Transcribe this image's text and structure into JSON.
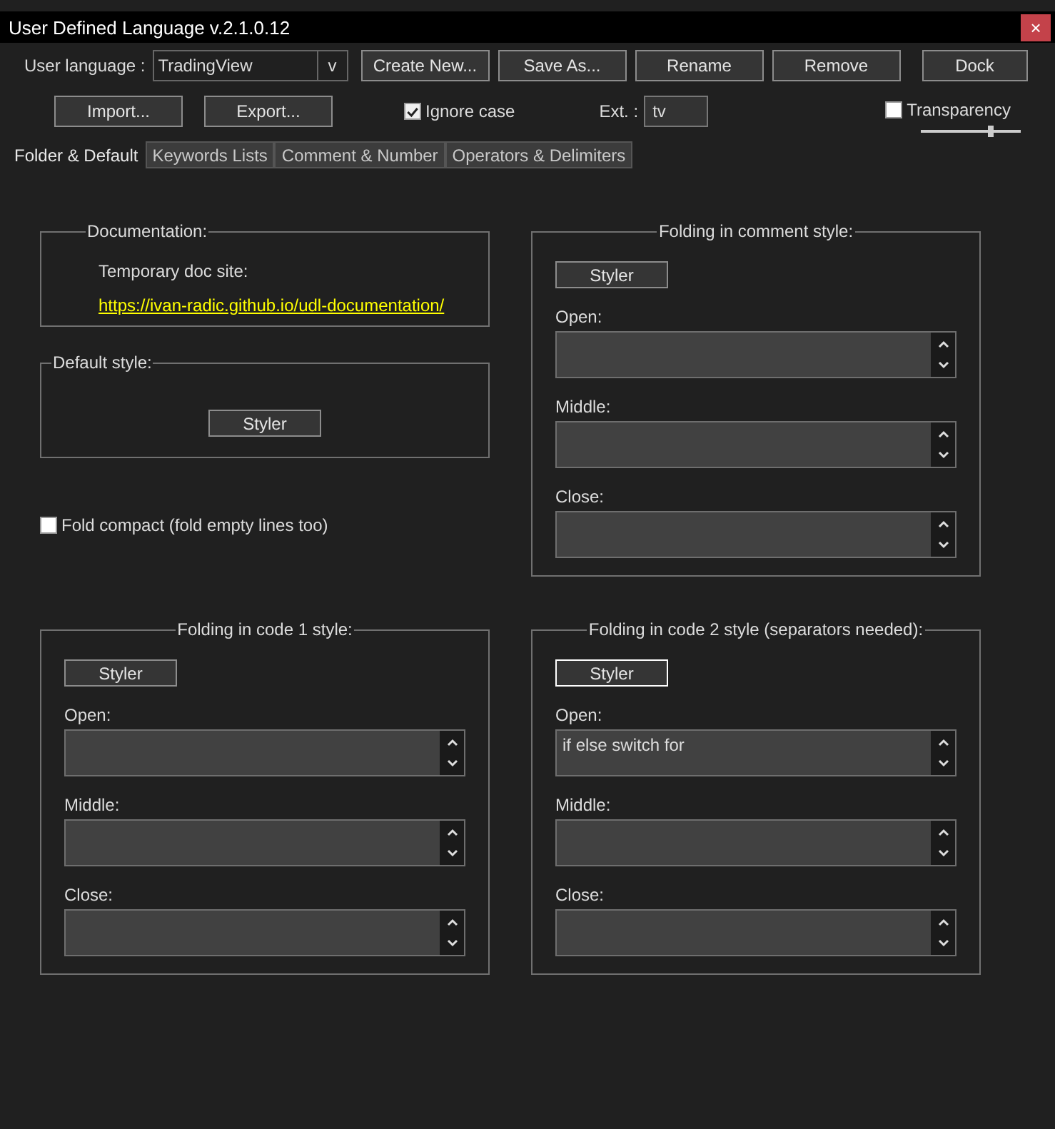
{
  "window": {
    "title": "User Defined Language v.2.1.0.12",
    "close": "×"
  },
  "language": {
    "label": "User language :",
    "value": "TradingView",
    "dropdown": "v"
  },
  "buttons": [
    "Create New...",
    "Save As...",
    "Rename",
    "Remove",
    "Dock"
  ],
  "import_export": [
    "Import...",
    "Export..."
  ],
  "ignore_case": {
    "label": "Ignore case",
    "checked": true
  },
  "ext": {
    "label": "Ext. :",
    "value": "tv"
  },
  "transparency": {
    "label": "Transparency",
    "checked": false,
    "level": 0.7
  },
  "tabs": [
    {
      "label": "Folder & Default",
      "selected": true
    },
    {
      "label": "Keywords Lists",
      "selected": false
    },
    {
      "label": "Comment & Number",
      "selected": false
    },
    {
      "label": "Operators & Delimiters",
      "selected": false
    }
  ],
  "documentation": {
    "title": "Documentation:",
    "label": "Temporary doc site:",
    "link": "https://ivan-radic.github.io/udl-documentation/"
  },
  "default_style": {
    "title": "Default style:",
    "button": "Styler"
  },
  "fold_compact": {
    "label": "Fold compact (fold empty lines too)",
    "checked": false
  },
  "folding": [
    {
      "title": "Folding in comment style:",
      "button": "Styler",
      "focused": false,
      "fields": [
        {
          "label": "Open:"
        },
        {
          "label": "Middle:"
        },
        {
          "label": "Close:"
        }
      ]
    },
    {
      "title": "Folding in code 1 style:",
      "button": "Styler",
      "focused": false,
      "fields": [
        {
          "label": "Open:"
        },
        {
          "label": "Middle:"
        },
        {
          "label": "Close:"
        }
      ]
    },
    {
      "title": "Folding in code 2 style (separators needed):",
      "button": "Styler",
      "focused": true,
      "fields": [
        {
          "label": "Open:",
          "value": "if else switch for"
        },
        {
          "label": "Middle:"
        },
        {
          "label": "Close:"
        }
      ]
    }
  ]
}
